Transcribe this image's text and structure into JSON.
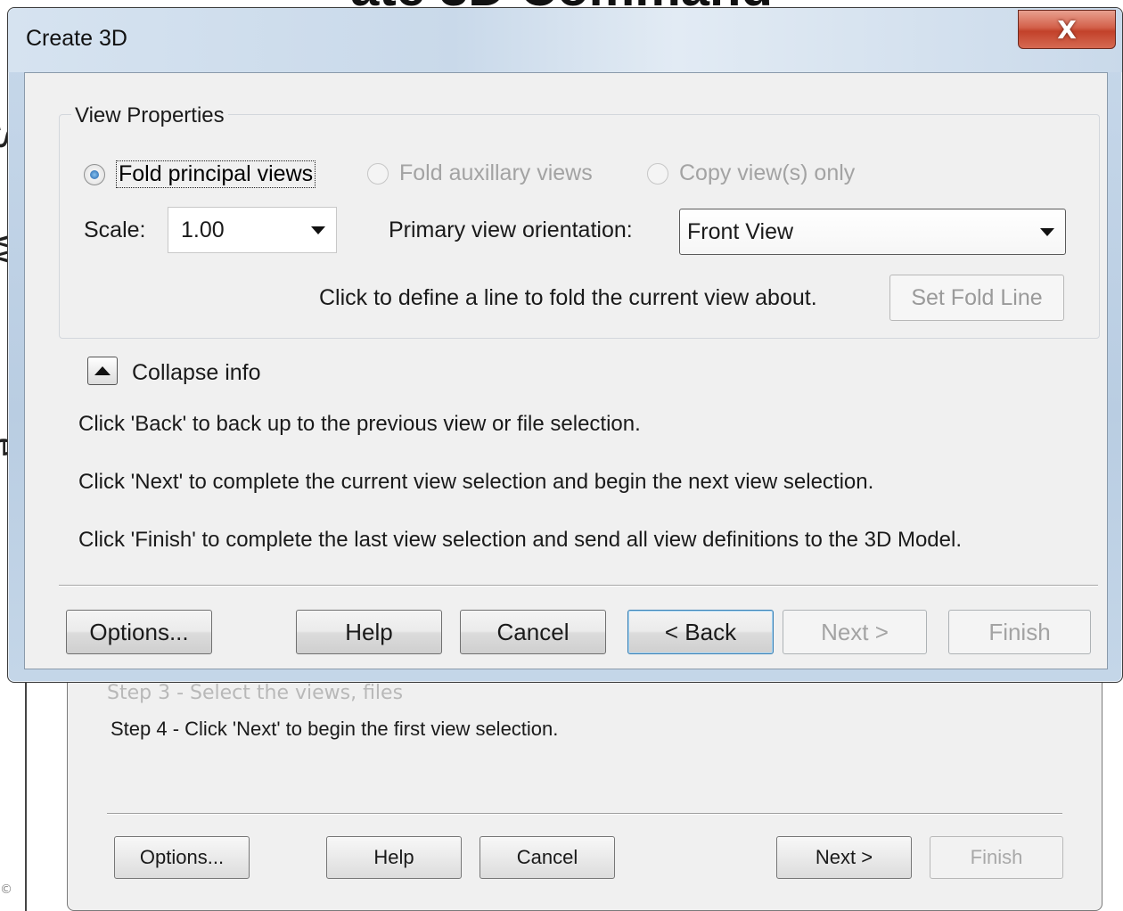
{
  "background": {
    "heading_fragment": "ate 3D Command",
    "dialog": {
      "faded_text": "Step 3 - Select the views, files",
      "step_text": "Step 4 - Click 'Next' to begin the first view selection.",
      "buttons": {
        "options": "Options...",
        "help": "Help",
        "cancel": "Cancel",
        "next": "Next >",
        "finish": "Finish"
      }
    }
  },
  "dialog": {
    "title": "Create 3D",
    "close_glyph": "X",
    "view_properties": {
      "legend": "View Properties",
      "radios": [
        {
          "label": "Fold principal views",
          "selected": true,
          "enabled": true
        },
        {
          "label": "Fold auxillary views",
          "selected": false,
          "enabled": false
        },
        {
          "label": "Copy view(s) only",
          "selected": false,
          "enabled": false
        }
      ],
      "scale_label": "Scale:",
      "scale_value": "1.00",
      "orientation_label": "Primary view orientation:",
      "orientation_value": "Front View",
      "fold_hint": "Click to define a line to fold the current view about.",
      "set_fold_line": "Set Fold Line"
    },
    "collapse_label": "Collapse info",
    "info_lines": [
      "Click 'Back' to back up to the previous view or file selection.",
      "Click 'Next' to complete the current view selection and begin the next view selection.",
      "Click 'Finish' to complete the last view selection and send all view definitions to the 3D Model."
    ],
    "buttons": {
      "options": "Options...",
      "help": "Help",
      "cancel": "Cancel",
      "back": "< Back",
      "next": "Next >",
      "finish": "Finish"
    }
  }
}
